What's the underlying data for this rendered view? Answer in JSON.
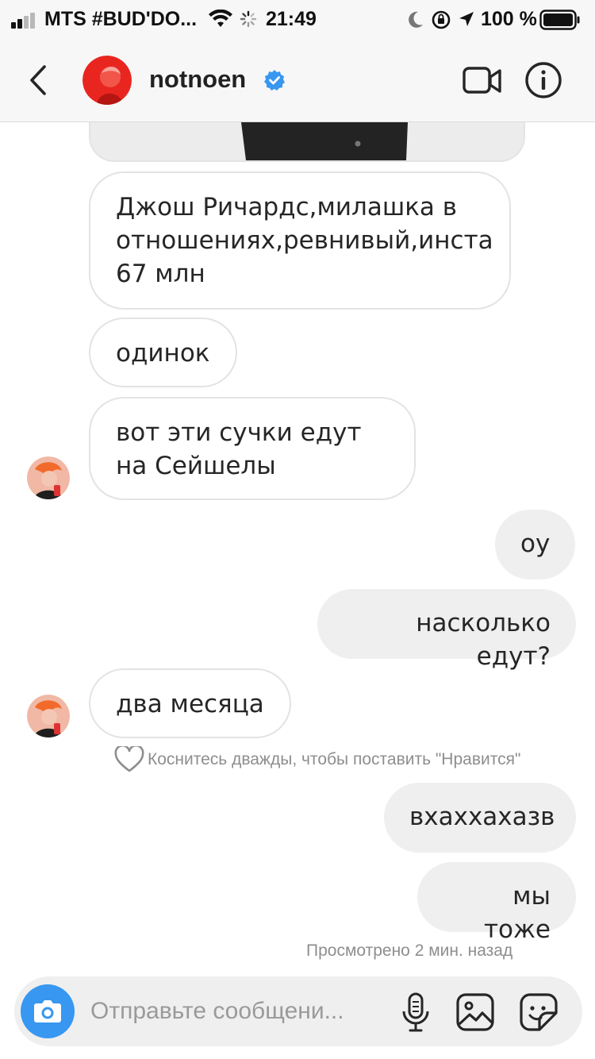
{
  "status_bar": {
    "carrier": "MTS #BUD'DO...",
    "time": "21:49",
    "battery": "100 %"
  },
  "header": {
    "username": "notnoen",
    "verified": true,
    "back_icon": "chevron-left-icon",
    "video_icon": "video-camera-icon",
    "info_icon": "info-icon"
  },
  "messages": [
    {
      "direction": "in",
      "text": "Джош Ричардс,милашка в отношениях,ревнивый,инста 67 млн"
    },
    {
      "direction": "in",
      "text": "одинок"
    },
    {
      "direction": "in",
      "text": "вот эти сучки едут на Сейшелы"
    },
    {
      "direction": "out",
      "text": "оу"
    },
    {
      "direction": "out",
      "text": "насколько едут?"
    },
    {
      "direction": "in",
      "text": "два месяца"
    },
    {
      "direction": "out",
      "text": "вхаххахазв"
    },
    {
      "direction": "out",
      "text": "мы тоже"
    }
  ],
  "like_hint": "Коснитесь дважды, чтобы поставить \"Нравится\"",
  "seen_status": "Просмотрено 2 мин. назад",
  "composer": {
    "placeholder": "Отправьте сообщени...",
    "icons": [
      "camera-icon",
      "microphone-icon",
      "gallery-icon",
      "sticker-icon"
    ]
  },
  "colors": {
    "accent": "#3897f0",
    "verified": "#3897f0",
    "incoming_border": "#e3e3e3",
    "outgoing_bg": "#efefef",
    "meta_text": "#8e8e8e"
  }
}
